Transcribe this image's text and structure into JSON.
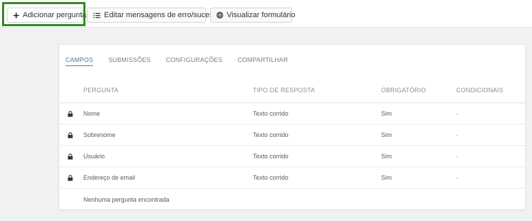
{
  "toolbar": {
    "add_label": "Adicionar pergunta",
    "edit_label": "Editar mensagens de erro/sucesso",
    "view_label": "Visualizar formulário"
  },
  "tabs": [
    {
      "label": "CAMPOS",
      "active": true
    },
    {
      "label": "SUBMISSÕES",
      "active": false
    },
    {
      "label": "CONFIGURAÇÕES",
      "active": false
    },
    {
      "label": "COMPARTILHAR",
      "active": false
    }
  ],
  "table": {
    "headers": {
      "question": "PERGUNTA",
      "type": "TIPO DE RESPOSTA",
      "required": "OBRIGATÓRIO",
      "conditional": "CONDICIONAIS"
    },
    "rows": [
      {
        "question": "Nome",
        "type": "Texto corrido",
        "required": "Sim",
        "conditional": "-",
        "locked": true
      },
      {
        "question": "Sobrenome",
        "type": "Texto corrido",
        "required": "Sim",
        "conditional": "-",
        "locked": true
      },
      {
        "question": "Usuário",
        "type": "Texto corrido",
        "required": "Sim",
        "conditional": "-",
        "locked": true
      },
      {
        "question": "Endereço de email",
        "type": "Texto corrido",
        "required": "Sim",
        "conditional": "-",
        "locked": true
      }
    ],
    "empty_message": "Nenhuma pergunta encontrada"
  },
  "colors": {
    "highlight": "#2e8b1f",
    "active_tab": "#4a78a8"
  },
  "icons": {
    "add": "plus-icon",
    "edit": "list-icon",
    "view": "globe-icon",
    "row": "lock-icon"
  }
}
